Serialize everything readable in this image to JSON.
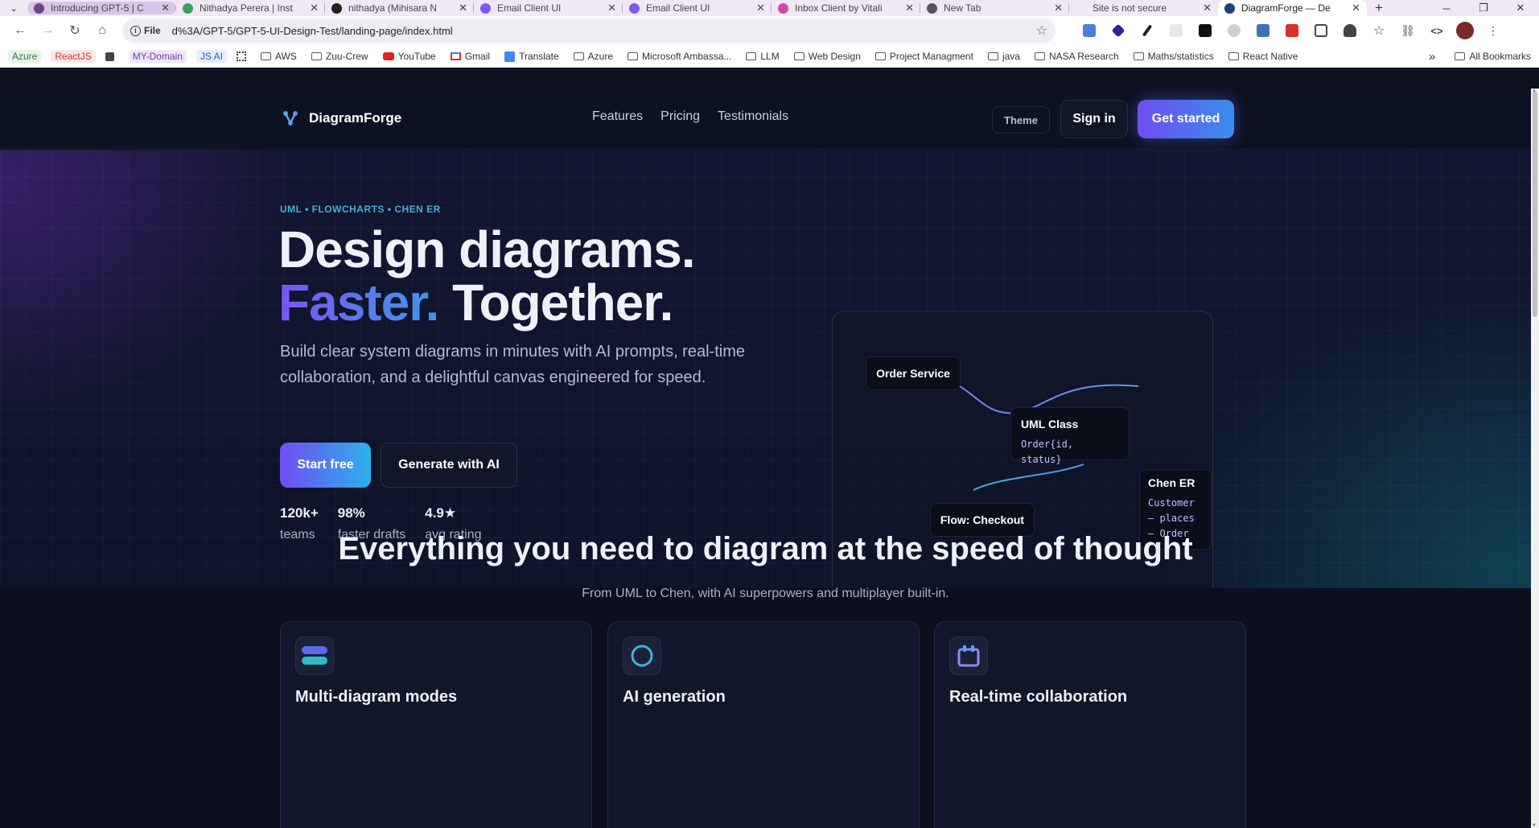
{
  "browser": {
    "tabs": [
      {
        "title": "Introducing GPT-5 | C",
        "favicon_color": "#6b4a82"
      },
      {
        "title": "Nithadya Perera | Inst",
        "favicon_color": "#3aa35a"
      },
      {
        "title": "nithadya (Mihisara N",
        "favicon_color": "#222222"
      },
      {
        "title": "Email Client UI",
        "favicon_color": "#7c5cf0"
      },
      {
        "title": "Email Client UI",
        "favicon_color": "#7c5cf0"
      },
      {
        "title": "Inbox Client by Vitali",
        "favicon_color": "#d04aa0"
      },
      {
        "title": "New Tab",
        "favicon_color": "#555555"
      },
      {
        "title": "Site is not secure",
        "favicon_color": "#f1e8f6"
      },
      {
        "title": "DiagramForge — De",
        "favicon_color": "#1c3f80"
      }
    ],
    "address": {
      "security_label": "File",
      "url": "d%3A/GPT-5/GPT-5-UI-Design-Test/landing-page/index.html"
    },
    "bookmarks": [
      {
        "label": "Azure",
        "kind": "pill",
        "color": "#2f7d3a",
        "bg": "#e7f3e8"
      },
      {
        "label": "ReactJS",
        "kind": "pill",
        "color": "#c23a2c",
        "bg": "#fbe9e7"
      },
      {
        "label": "",
        "kind": "square"
      },
      {
        "label": "MY-Domain",
        "kind": "pill",
        "color": "#6b3fa8",
        "bg": "#efe6f8"
      },
      {
        "label": "JS AI",
        "kind": "pill",
        "color": "#2a5fb8",
        "bg": "#e6eefb"
      },
      {
        "label": "",
        "kind": "apps"
      },
      {
        "label": "AWS",
        "kind": "folder"
      },
      {
        "label": "Zuu-Crew",
        "kind": "folder"
      },
      {
        "label": "YouTube",
        "kind": "youtube"
      },
      {
        "label": "Gmail",
        "kind": "gmail"
      },
      {
        "label": "Translate",
        "kind": "translate"
      },
      {
        "label": "Azure",
        "kind": "folder"
      },
      {
        "label": "Microsoft Ambassa...",
        "kind": "folder"
      },
      {
        "label": "LLM",
        "kind": "folder"
      },
      {
        "label": "Web Design",
        "kind": "folder"
      },
      {
        "label": "Project Managment",
        "kind": "folder"
      },
      {
        "label": "java",
        "kind": "folder"
      },
      {
        "label": "NASA Research",
        "kind": "folder"
      },
      {
        "label": "Maths/statistics",
        "kind": "folder"
      },
      {
        "label": "React Native",
        "kind": "folder"
      }
    ],
    "all_bookmarks_label": "All Bookmarks",
    "overflow_glyph": "»"
  },
  "site": {
    "brand": "DiagramForge",
    "nav": [
      "Features",
      "Pricing",
      "Testimonials"
    ],
    "theme_label": "Theme",
    "signin_label": "Sign in",
    "get_started_label": "Get started"
  },
  "hero": {
    "eyebrow": "UML • FLOWCHARTS • CHEN ER",
    "headline_line1": "Design diagrams.",
    "headline_accent": "Faster.",
    "headline_rest": " Together.",
    "lede": "Build clear system diagrams in minutes with AI prompts, real-time collaboration, and a delightful canvas engineered for speed.",
    "primary_cta": "Start free",
    "secondary_cta": "Generate with AI",
    "stats": [
      {
        "value": "120k+",
        "label": "teams"
      },
      {
        "value": "98%",
        "label": "faster drafts"
      },
      {
        "value": "4.9★",
        "label": "avg rating"
      }
    ]
  },
  "canvas": {
    "nodes": {
      "order_service": {
        "title": "Order Service"
      },
      "uml_class": {
        "title": "UML Class",
        "code": "Order{id, status}"
      },
      "flow_checkout": {
        "title": "Flow: Checkout"
      },
      "chen_er": {
        "title": "Chen ER",
        "lines": [
          "Customer",
          "— places",
          "— Order"
        ]
      }
    }
  },
  "features": {
    "title": "Everything you need to diagram at the speed of thought",
    "subtitle": "From UML to Chen, with AI superpowers and multiplayer built-in.",
    "cards": [
      {
        "icon": "layers-icon",
        "title": "Multi-diagram modes"
      },
      {
        "icon": "ring-icon",
        "title": "AI generation"
      },
      {
        "icon": "calendar-icon",
        "title": "Real-time collaboration"
      }
    ]
  },
  "colors": {
    "accent_purple": "#6d4ef0",
    "accent_blue": "#3a8dee",
    "eyebrow_cyan": "#3fb3d6"
  }
}
